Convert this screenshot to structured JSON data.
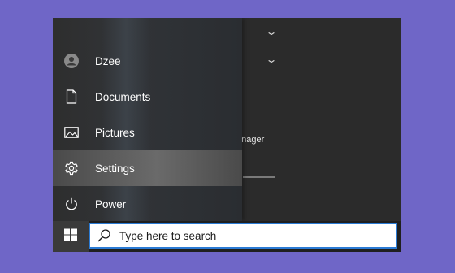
{
  "start_menu": {
    "items": [
      {
        "label": "Dzee",
        "icon": "avatar-icon"
      },
      {
        "label": "Documents",
        "icon": "document-icon"
      },
      {
        "label": "Pictures",
        "icon": "pictures-icon"
      },
      {
        "label": "Settings",
        "icon": "gear-icon"
      },
      {
        "label": "Power",
        "icon": "power-icon"
      }
    ],
    "active_item": "Settings"
  },
  "background_app": {
    "visible_text": "anager"
  },
  "taskbar": {
    "search_placeholder": "Type here to search"
  },
  "colors": {
    "desktop": "#6f66c7",
    "search_border": "#2b7bd4"
  }
}
